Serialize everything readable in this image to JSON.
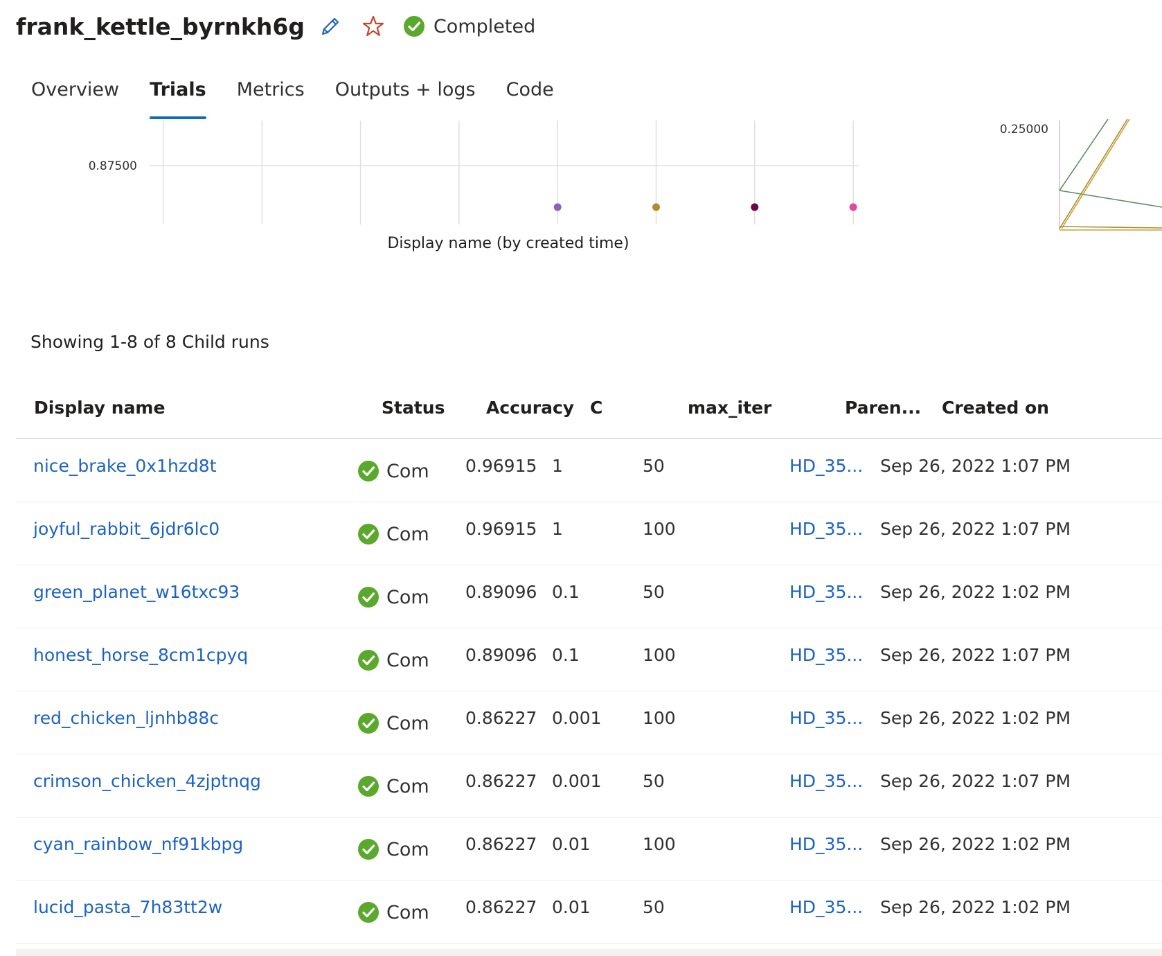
{
  "header": {
    "title": "frank_kettle_byrnkh6g",
    "status": "Completed",
    "colors": {
      "edit": "#1b62c6",
      "favorite": "#c4472c",
      "success": "#5aa82c"
    }
  },
  "tabs": [
    {
      "label": "Overview",
      "active": false
    },
    {
      "label": "Trials",
      "active": true
    },
    {
      "label": "Metrics",
      "active": false
    },
    {
      "label": "Outputs + logs",
      "active": false
    },
    {
      "label": "Code",
      "active": false
    }
  ],
  "chart_data": [
    {
      "type": "scatter",
      "title": "",
      "xlabel": "Display name (by created time)",
      "ylabel": "",
      "y_tick_labels": [
        "0.87500"
      ],
      "grid": true,
      "points": [
        {
          "index": 5,
          "color": "#8764b8"
        },
        {
          "index": 6,
          "color": "#b28c2a"
        },
        {
          "index": 7,
          "color": "#6b0a3e"
        },
        {
          "index": 8,
          "color": "#e3479e"
        }
      ],
      "x_categories_count": 8
    },
    {
      "type": "line",
      "title": "",
      "xlabel": "",
      "ylabel": "",
      "y_tick_labels": [
        "0.25000"
      ],
      "series_colors": [
        "#5e8f5e",
        "#b28c2a",
        "#c9a23a"
      ],
      "partially_visible": true
    }
  ],
  "child_runs": {
    "summary": "Showing 1-8 of 8 Child runs",
    "columns": [
      "Display name",
      "Status",
      "Accuracy",
      "C",
      "max_iter",
      "Paren...",
      "Created on"
    ],
    "rows": [
      {
        "name": "nice_brake_0x1hzd8t",
        "status": "Com",
        "accuracy": "0.96915",
        "c": "1",
        "max_iter": "50",
        "parent": "HD_35...",
        "created": "Sep 26, 2022 1:07 PM"
      },
      {
        "name": "joyful_rabbit_6jdr6lc0",
        "status": "Com",
        "accuracy": "0.96915",
        "c": "1",
        "max_iter": "100",
        "parent": "HD_35...",
        "created": "Sep 26, 2022 1:07 PM"
      },
      {
        "name": "green_planet_w16txc93",
        "status": "Com",
        "accuracy": "0.89096",
        "c": "0.1",
        "max_iter": "50",
        "parent": "HD_35...",
        "created": "Sep 26, 2022 1:02 PM"
      },
      {
        "name": "honest_horse_8cm1cpyq",
        "status": "Com",
        "accuracy": "0.89096",
        "c": "0.1",
        "max_iter": "100",
        "parent": "HD_35...",
        "created": "Sep 26, 2022 1:07 PM"
      },
      {
        "name": "red_chicken_ljnhb88c",
        "status": "Com",
        "accuracy": "0.86227",
        "c": "0.001",
        "max_iter": "100",
        "parent": "HD_35...",
        "created": "Sep 26, 2022 1:02 PM"
      },
      {
        "name": "crimson_chicken_4zjptnqg",
        "status": "Com",
        "accuracy": "0.86227",
        "c": "0.001",
        "max_iter": "50",
        "parent": "HD_35...",
        "created": "Sep 26, 2022 1:07 PM"
      },
      {
        "name": "cyan_rainbow_nf91kbpg",
        "status": "Com",
        "accuracy": "0.86227",
        "c": "0.01",
        "max_iter": "100",
        "parent": "HD_35...",
        "created": "Sep 26, 2022 1:02 PM"
      },
      {
        "name": "lucid_pasta_7h83tt2w",
        "status": "Com",
        "accuracy": "0.86227",
        "c": "0.01",
        "max_iter": "50",
        "parent": "HD_35...",
        "created": "Sep 26, 2022 1:02 PM"
      }
    ]
  }
}
